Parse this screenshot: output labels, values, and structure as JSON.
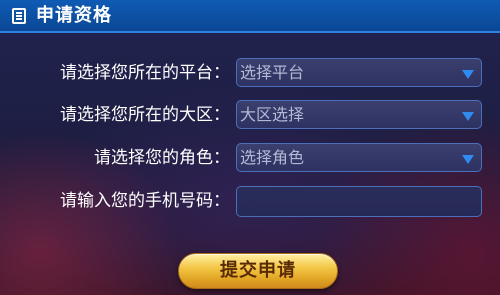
{
  "header": {
    "title": "申请资格",
    "icon": "document-icon"
  },
  "form": {
    "platform": {
      "label": "请选择您所在的平台：",
      "selected": "选择平台"
    },
    "region": {
      "label": "请选择您所在的大区：",
      "selected": "大区选择"
    },
    "role": {
      "label": "请选择您的角色：",
      "selected": "选择角色"
    },
    "phone": {
      "label": "请输入您的手机号码：",
      "value": ""
    },
    "submit_label": "提交申请"
  },
  "colors": {
    "header_bg": "#0a4794",
    "dropdown_arrow": "#2f8bf0",
    "button_gold": "#f3c746",
    "button_text": "#5a2a05"
  }
}
